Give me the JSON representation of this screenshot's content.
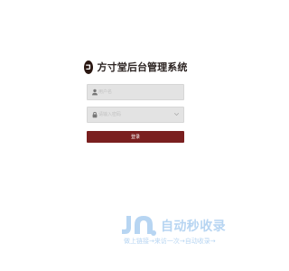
{
  "app": {
    "title": "方寸堂后台管理系统"
  },
  "login_form": {
    "username_placeholder": "用户名",
    "password_placeholder": "请输入密码",
    "login_button": "登录"
  },
  "watermark": {
    "title": "自动秒收录",
    "subtitle": "做上链接→来访一次→自动收录→"
  },
  "colors": {
    "accent": "#7a1f1f",
    "field_background": "#e3e3e3",
    "watermark": "#b7d5f2"
  },
  "icons": {
    "logo": "brand-logo-icon",
    "username": "user-icon",
    "password": "lock-icon",
    "password_suffix": "chevron-down-icon"
  }
}
